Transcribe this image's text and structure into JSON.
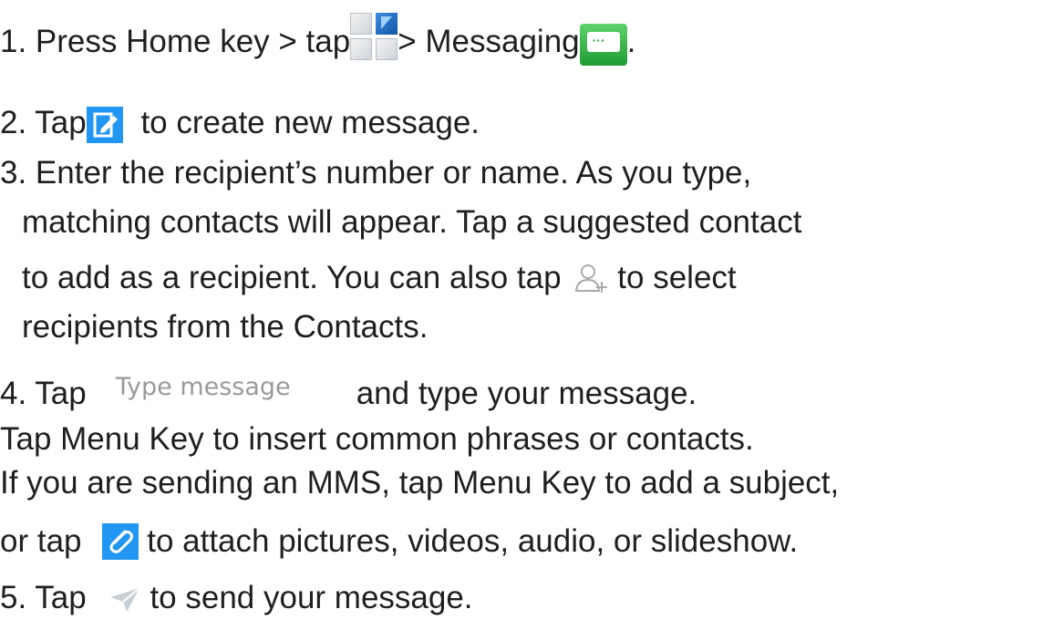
{
  "step1": {
    "prefix": "1. Press Home key > tap",
    "middle": "> Messaging",
    "end": ".",
    "apps_icon": "apps-grid-icon",
    "messaging_icon": "messaging-app-icon"
  },
  "step2": {
    "prefix": "2. Tap",
    "suffix": " to create new message.",
    "compose_icon": "compose-icon"
  },
  "step3": {
    "line1": "3. Enter the recipient’s number or name. As you type,",
    "line2": "matching contacts will appear. Tap a suggested contact",
    "line3_prefix": "to add as a recipient. You can also tap",
    "line3_suffix": " to select",
    "line4": "recipients from the Contacts.",
    "add_contact_icon": "add-contact-icon"
  },
  "step4": {
    "prefix": "4. Tap",
    "field_text": "Type message",
    "suffix": "and type your message.",
    "line2": "Tap Menu Key to insert common phrases or contacts.",
    "line3": "If you are sending an MMS, tap Menu Key to add a subject,",
    "line4_prefix": "or tap",
    "line4_suffix": " to attach pictures, videos, audio, or slideshow.",
    "attach_icon": "attach-icon"
  },
  "step5": {
    "prefix": "5. Tap",
    "suffix": " to send your message.",
    "send_icon": "send-icon"
  },
  "colors": {
    "text": "#1f1f1f",
    "icon_blue": "#2196f3",
    "icon_green": "#1f9b34",
    "placeholder_gray": "#9a9a9a"
  }
}
